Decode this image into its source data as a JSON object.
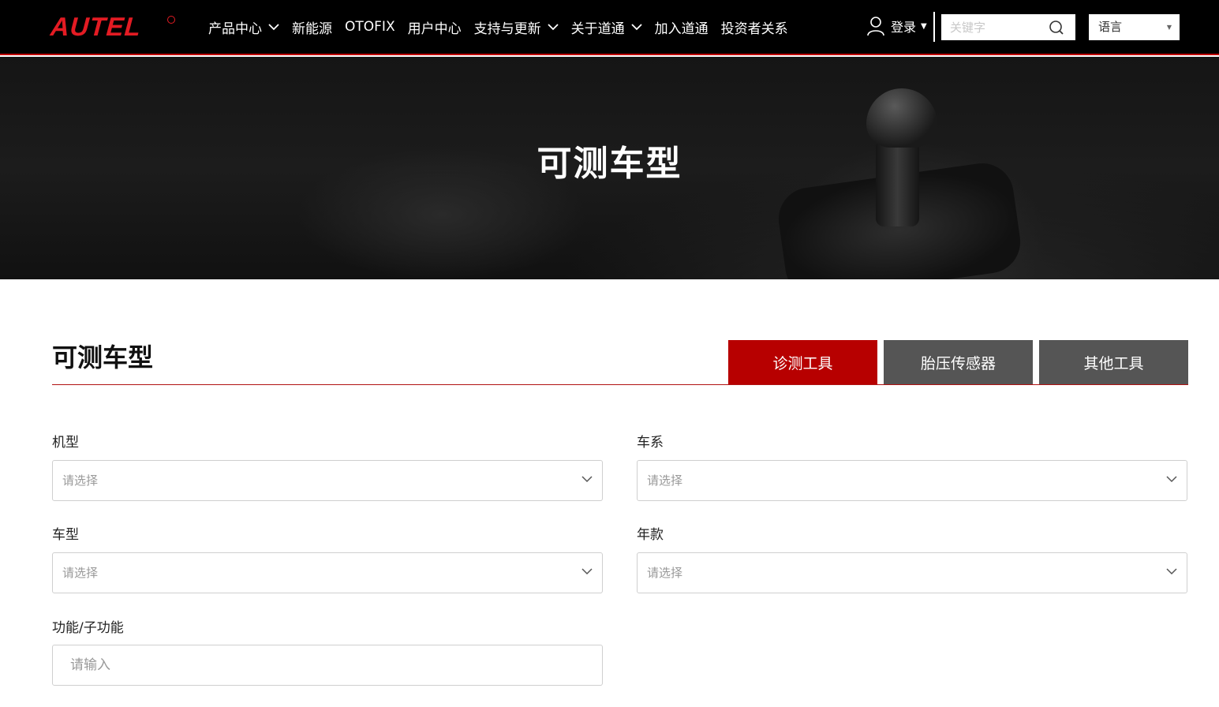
{
  "brand": {
    "logo_text": "AUTEL",
    "accent_color": "#e31b23"
  },
  "nav": {
    "items": [
      {
        "label": "产品中心",
        "has_dropdown": true
      },
      {
        "label": "新能源",
        "has_dropdown": false
      },
      {
        "label": "OTOFIX",
        "has_dropdown": false
      },
      {
        "label": "用户中心",
        "has_dropdown": false
      },
      {
        "label": "支持与更新",
        "has_dropdown": true
      },
      {
        "label": "关于道通",
        "has_dropdown": true
      },
      {
        "label": "加入道通",
        "has_dropdown": false
      },
      {
        "label": "投资者关系",
        "has_dropdown": false
      }
    ]
  },
  "header": {
    "login_label": "登录",
    "search_placeholder": "关键字",
    "language_label": "语言",
    "icons": [
      "user-icon",
      "search-icon",
      "chevron-down-icon"
    ]
  },
  "banner": {
    "title": "可测车型"
  },
  "section": {
    "title": "可测车型",
    "tabs": [
      {
        "label": "诊测工具",
        "active": true
      },
      {
        "label": "胎压传感器",
        "active": false
      },
      {
        "label": "其他工具",
        "active": false
      }
    ],
    "active_color": "#b70000",
    "inactive_color": "#555555"
  },
  "form": {
    "fields": [
      {
        "label": "机型",
        "placeholder": "请选择"
      },
      {
        "label": "车系",
        "placeholder": "请选择"
      },
      {
        "label": "车型",
        "placeholder": "请选择"
      },
      {
        "label": "年款",
        "placeholder": "请选择"
      }
    ],
    "function_label": "功能/子功能",
    "function_placeholder": "请输入"
  }
}
